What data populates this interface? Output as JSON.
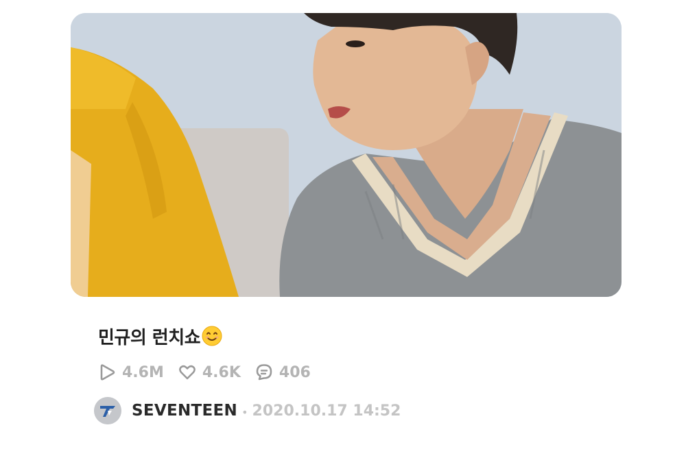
{
  "post": {
    "title": "민규의 런치쇼",
    "title_emoji": "smiling-face-emoji",
    "thumbnail_alt": "video-thumbnail"
  },
  "stats": {
    "plays": "4.6M",
    "likes": "4.6K",
    "comments": "406"
  },
  "icons": {
    "play": "play-icon",
    "like": "heart-icon",
    "comment": "comment-icon"
  },
  "author": {
    "name": "SEVENTEEN",
    "separator": "•",
    "date": "2020.10.17 14:52"
  },
  "colors": {
    "title": "#1f1f1f",
    "meta_gray": "#b4b4b4",
    "avatar_bg": "#c5c7cb",
    "logo_blue": "#2b5fa8"
  }
}
